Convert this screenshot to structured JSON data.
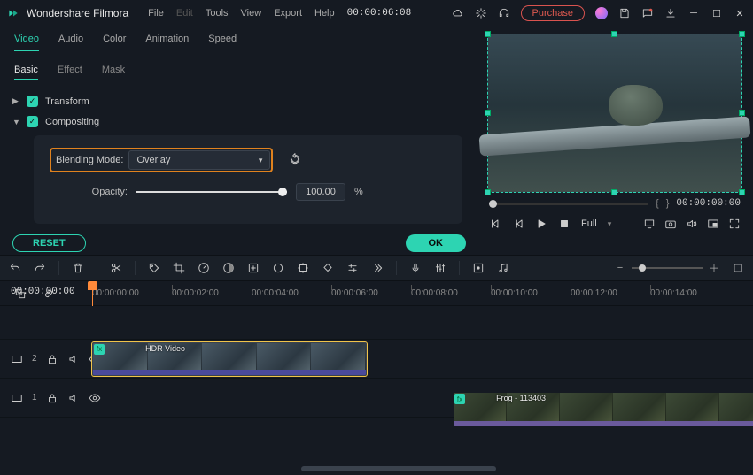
{
  "app": {
    "name": "Wondershare Filmora"
  },
  "menu": [
    "File",
    "Edit",
    "Tools",
    "View",
    "Export",
    "Help"
  ],
  "timecode": "00:00:06:08",
  "purchase": "Purchase",
  "tabs_primary": [
    "Video",
    "Audio",
    "Color",
    "Animation",
    "Speed"
  ],
  "tabs_secondary": [
    "Basic",
    "Effect",
    "Mask"
  ],
  "props": {
    "transform": "Transform",
    "compositing": "Compositing",
    "blend_label": "Blending Mode:",
    "blend_value": "Overlay",
    "opacity_label": "Opacity:",
    "opacity_value": "100.00",
    "opacity_unit": "%"
  },
  "buttons": {
    "reset": "RESET",
    "ok": "OK"
  },
  "preview": {
    "in_brace": "{",
    "out_brace": "}",
    "time": "00:00:00:00",
    "quality": "Full"
  },
  "ruler": {
    "now": "00:00:00:00",
    "ticks": [
      "00:00:00:00",
      "00:00:02:00",
      "00:00:04:00",
      "00:00:06:00",
      "00:00:08:00",
      "00:00:10:00",
      "00:00:12:00",
      "00:00:14:00"
    ]
  },
  "tracks": {
    "t2": {
      "label": "2",
      "clip_label": "HDR Video"
    },
    "t1": {
      "label": "1",
      "clip_label": "Frog - 113403"
    }
  }
}
